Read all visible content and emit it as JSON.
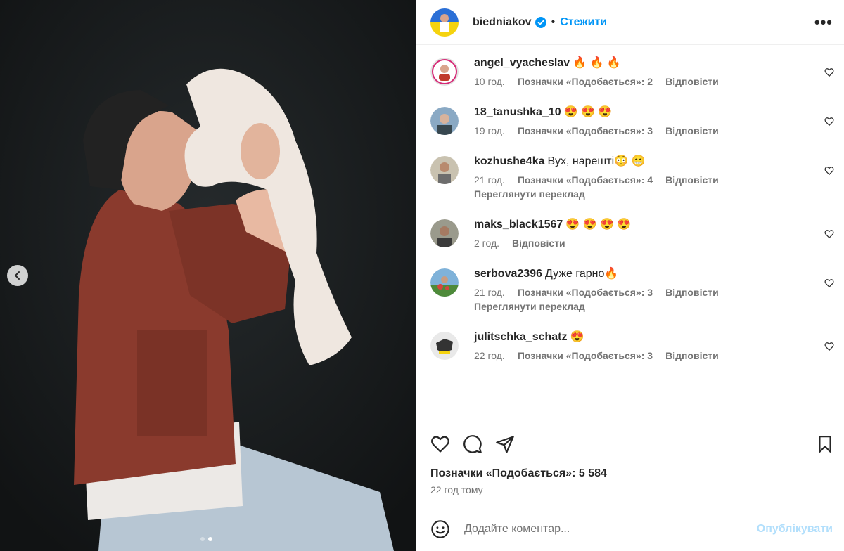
{
  "post": {
    "author": "biedniakov",
    "follow_label": "Стежити",
    "separator": "•",
    "more_label": "•••",
    "likes_label": "Позначки «Подобається»: 5 584",
    "time_label": "22 год тому",
    "carousel": {
      "total": 2,
      "active": 1
    }
  },
  "comments": [
    {
      "user": "angel_vyacheslav",
      "text": "🔥 🔥 🔥",
      "time": "10 год.",
      "likes": "Позначки «Подобається»: 2",
      "reply": "Відповісти",
      "translate": ""
    },
    {
      "user": "18_tanushka_10",
      "text": "😍 😍 😍",
      "time": "19 год.",
      "likes": "Позначки «Подобається»: 3",
      "reply": "Відповісти",
      "translate": ""
    },
    {
      "user": "kozhushe4ka",
      "text": "Вух, нарешті😳 😁",
      "time": "21 год.",
      "likes": "Позначки «Подобається»: 4",
      "reply": "Відповісти",
      "translate": "Переглянути переклад"
    },
    {
      "user": "maks_black1567",
      "text": "😍 😍 😍 😍",
      "time": "2 год.",
      "likes": "",
      "reply": "Відповісти",
      "translate": ""
    },
    {
      "user": "serbova2396",
      "text": "Дуже гарно🔥",
      "time": "21 год.",
      "likes": "Позначки «Подобається»: 3",
      "reply": "Відповісти",
      "translate": "Переглянути переклад"
    },
    {
      "user": "julitschka_schatz",
      "text": "😍",
      "time": "22 год.",
      "likes": "Позначки «Подобається»: 3",
      "reply": "Відповісти",
      "translate": ""
    }
  ],
  "add_comment": {
    "placeholder": "Додайте коментар...",
    "post_label": "Опублікувати"
  },
  "icons": {
    "prev": "chevron-left-icon",
    "verified": "verified-badge-icon",
    "comment_like": "heart-outline-icon",
    "like": "heart-icon",
    "comment": "speech-bubble-icon",
    "share": "paper-plane-icon",
    "save": "bookmark-icon",
    "emoji": "smiley-icon"
  },
  "colors": {
    "link": "#0095f6",
    "muted": "#737373",
    "post_disabled": "#b2dffc",
    "photo_bg": "#17191b"
  }
}
